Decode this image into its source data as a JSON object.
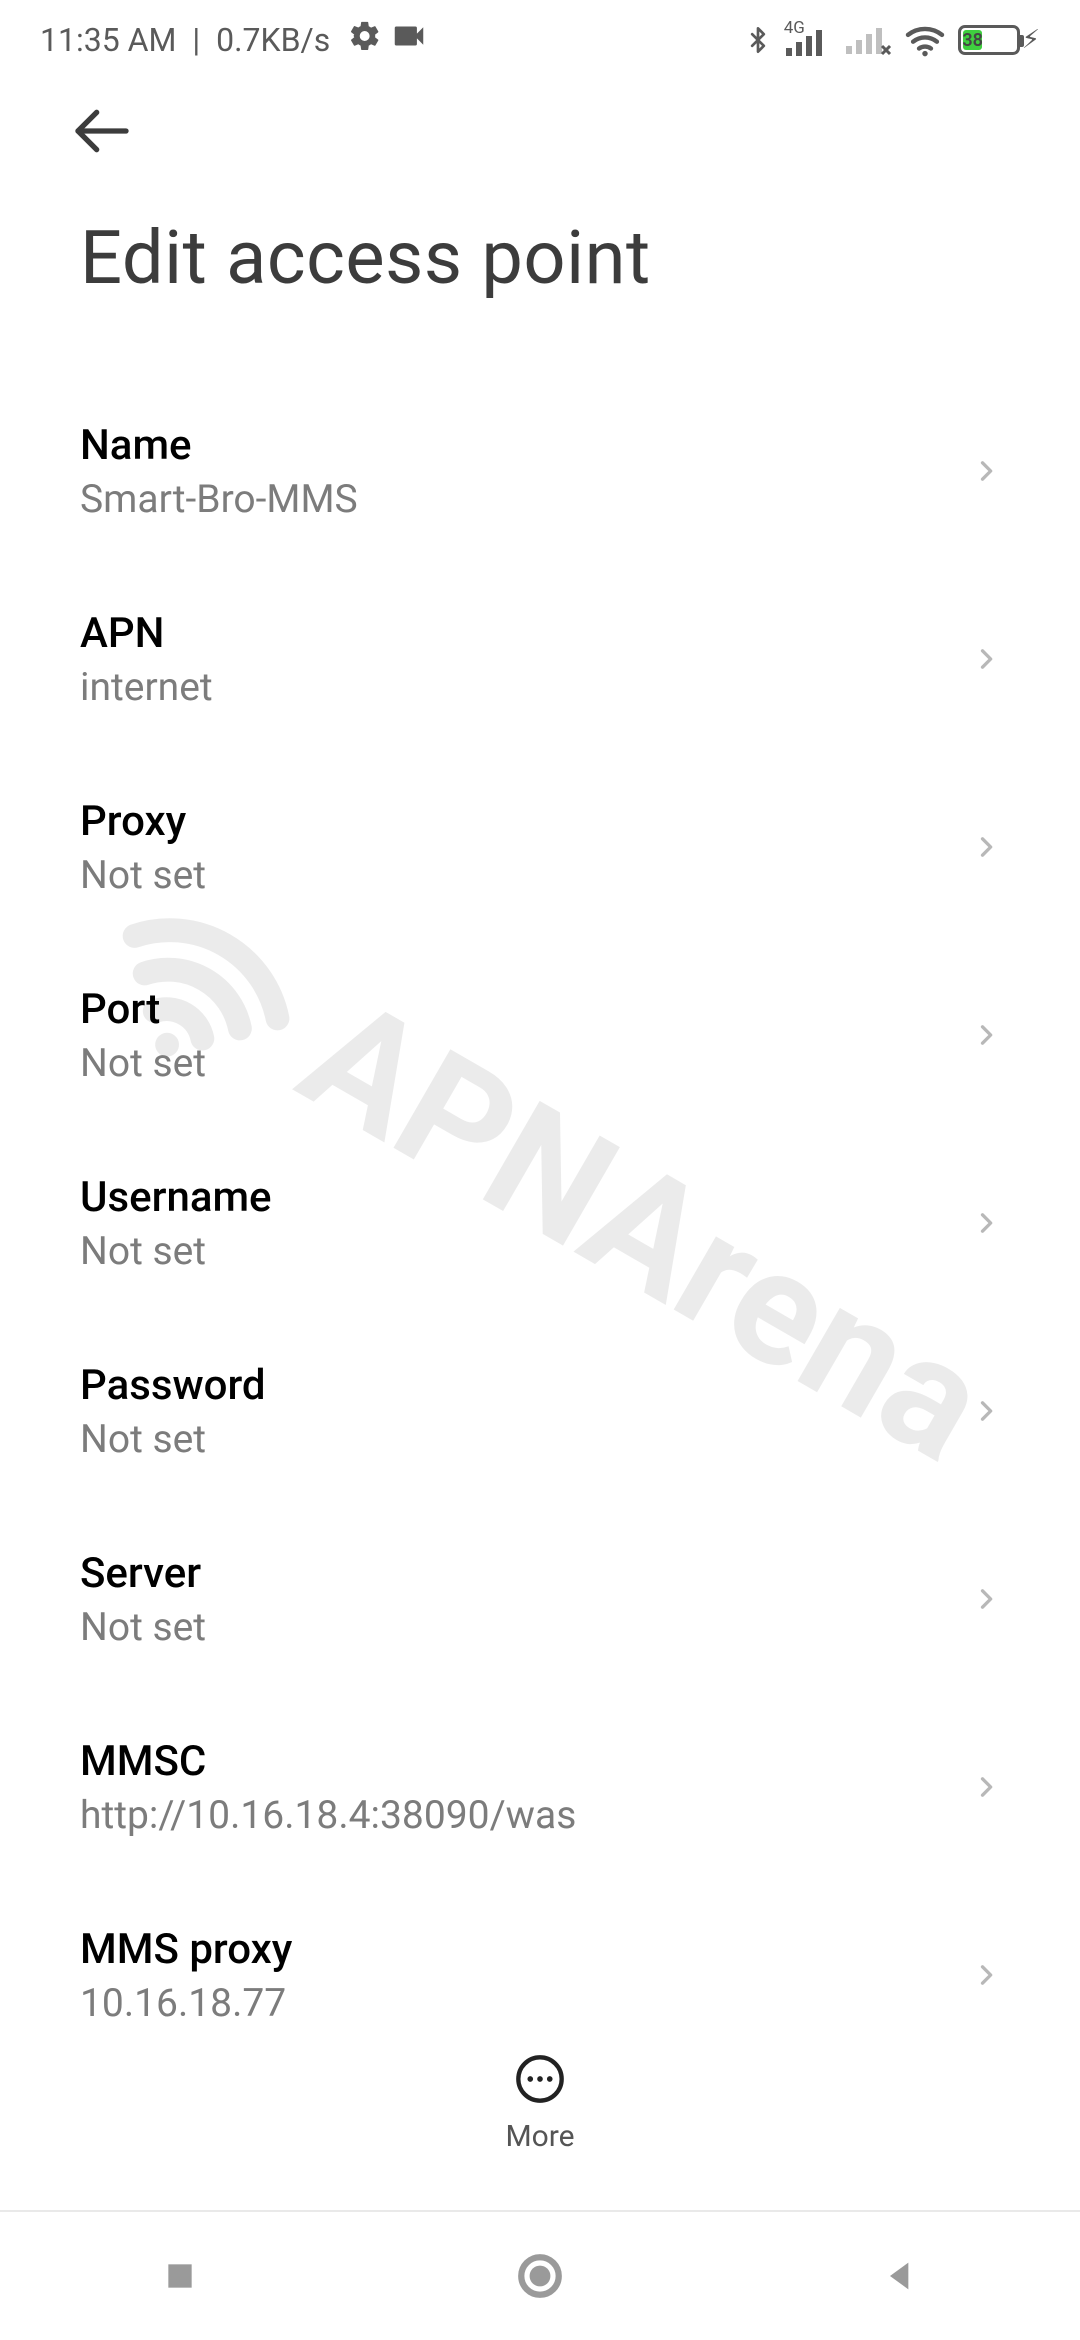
{
  "status": {
    "time": "11:35 AM",
    "net_speed": "0.7KB/s",
    "battery_pct": 38
  },
  "header": {
    "title": "Edit access point"
  },
  "fields": [
    {
      "id": "name",
      "label": "Name",
      "value": "Smart-Bro-MMS"
    },
    {
      "id": "apn",
      "label": "APN",
      "value": "internet"
    },
    {
      "id": "proxy",
      "label": "Proxy",
      "value": "Not set"
    },
    {
      "id": "port",
      "label": "Port",
      "value": "Not set"
    },
    {
      "id": "username",
      "label": "Username",
      "value": "Not set"
    },
    {
      "id": "password",
      "label": "Password",
      "value": "Not set"
    },
    {
      "id": "server",
      "label": "Server",
      "value": "Not set"
    },
    {
      "id": "mmsc",
      "label": "MMSC",
      "value": "http://10.16.18.4:38090/was"
    },
    {
      "id": "mms-proxy",
      "label": "MMS proxy",
      "value": "10.16.18.77"
    }
  ],
  "action_bar": {
    "more_label": "More"
  },
  "watermark": "APNArena"
}
